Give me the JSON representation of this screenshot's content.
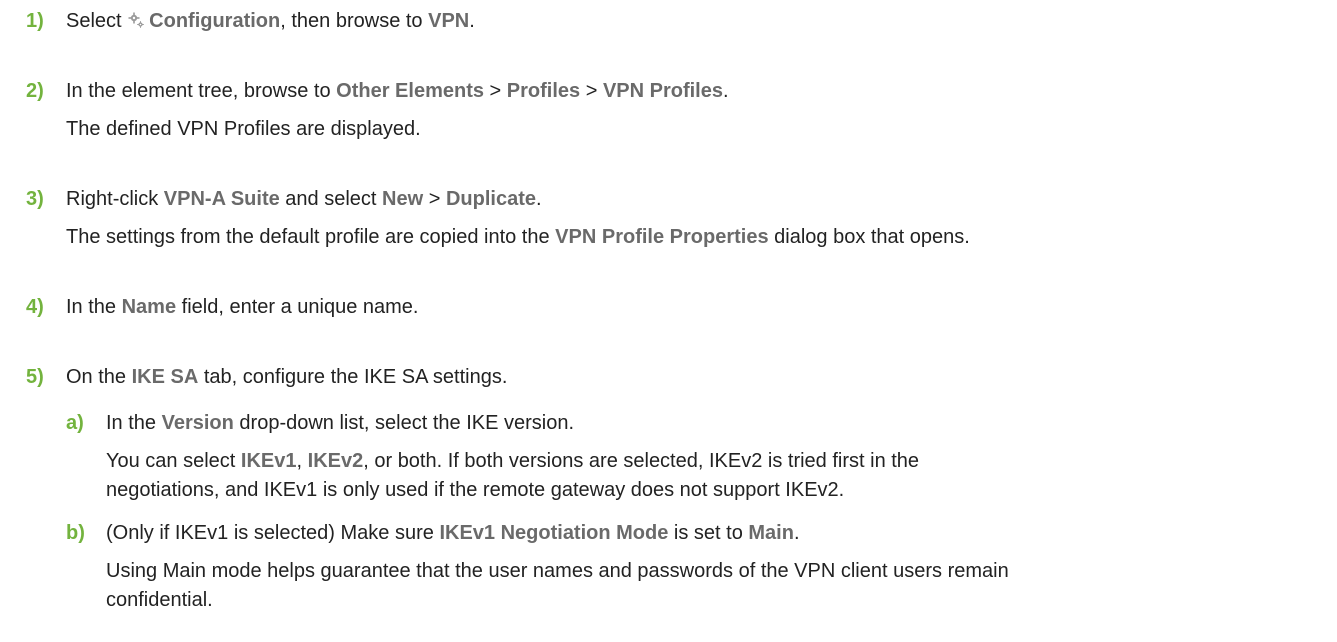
{
  "steps": [
    {
      "num": "1)",
      "line1": {
        "t1": "Select ",
        "ui1": "Configuration",
        "t2": ", then browse to ",
        "ui2": "VPN",
        "t3": "."
      }
    },
    {
      "num": "2)",
      "line1": {
        "t1": "In the element tree, browse to ",
        "ui1": "Other Elements",
        "t2": " > ",
        "ui2": "Profiles",
        "t3": " > ",
        "ui3": "VPN Profiles",
        "t4": "."
      },
      "line2": "The defined VPN Profiles are displayed."
    },
    {
      "num": "3)",
      "line1": {
        "t1": "Right-click ",
        "ui1": "VPN-A Suite",
        "t2": " and select ",
        "ui2": "New",
        "t3": " > ",
        "ui3": "Duplicate",
        "t4": "."
      },
      "line2": {
        "t1": "The settings from the default profile are copied into the ",
        "ui1": "VPN Profile Properties",
        "t2": " dialog box that opens."
      }
    },
    {
      "num": "4)",
      "line1": {
        "t1": "In the ",
        "ui1": "Name",
        "t2": " field, enter a unique name."
      }
    },
    {
      "num": "5)",
      "line1": {
        "t1": "On the ",
        "ui1": "IKE SA",
        "t2": " tab, configure the IKE SA settings."
      }
    }
  ],
  "substeps": [
    {
      "num": "a)",
      "line1": {
        "t1": "In the ",
        "ui1": "Version",
        "t2": " drop-down list, select the IKE version."
      },
      "line2": {
        "t1": "You can select ",
        "ui1": "IKEv1",
        "t2": ", ",
        "ui2": "IKEv2",
        "t3": ", or both. If both versions are selected, IKEv2 is tried first in the"
      },
      "line3": "negotiations, and IKEv1 is only used if the remote gateway does not support IKEv2."
    },
    {
      "num": "b)",
      "line1": {
        "t1": "(Only if IKEv1 is selected) Make sure ",
        "ui1": "IKEv1 Negotiation Mode",
        "t2": " is set to ",
        "ui2": "Main",
        "t3": "."
      },
      "line2": "Using Main mode helps guarantee that the user names and passwords of the VPN client users remain",
      "line3": "confidential."
    }
  ],
  "icons": {
    "configuration": "gear-icon"
  },
  "colors": {
    "step_number": "#73b33e",
    "ui_term": "#6a6a6a",
    "body_text": "#222222"
  }
}
